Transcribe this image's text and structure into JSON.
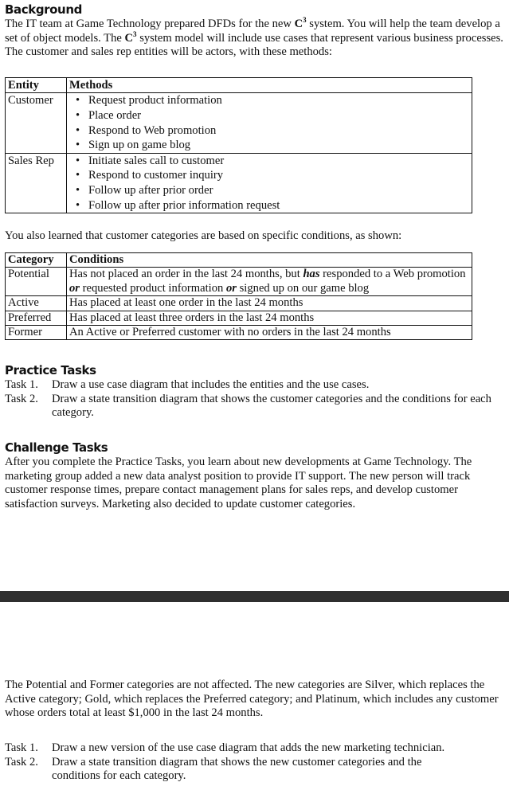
{
  "background": {
    "heading": "Background",
    "para_part1": "The IT team at Game Technology prepared DFDs for the new ",
    "system_name": "C",
    "system_sup": "3",
    "para_part2": " system. You will help the team develop a set of object models. The ",
    "para_part3": " system model will include use cases that represent various business processes. The customer and sales rep entities will be actors, with these methods:"
  },
  "entities_table": {
    "headers": [
      "Entity",
      "Methods"
    ],
    "rows": [
      {
        "entity": "Customer",
        "methods": [
          "Request product information",
          "Place order",
          "Respond to Web promotion",
          "Sign up on game blog"
        ]
      },
      {
        "entity": "Sales Rep",
        "methods": [
          "Initiate sales call to customer",
          "Respond to customer inquiry",
          "Follow up after prior order",
          "Follow up after prior information request"
        ]
      }
    ],
    "bullet": "•"
  },
  "categories_intro": "You also learned that customer categories are based on specific conditions, as shown:",
  "categories_table": {
    "headers": [
      "Category",
      "Conditions"
    ],
    "rows": [
      {
        "category": "Potential",
        "cond_a": "Has not placed an order in the last 24 months, but ",
        "cond_b": "has",
        "cond_c": " responded to a Web promotion ",
        "cond_d": "or",
        "cond_e": " requested product information ",
        "cond_f": "or",
        "cond_g": " signed up on our game blog"
      },
      {
        "category": "Active",
        "condition": "Has placed at least one order in the last 24 months"
      },
      {
        "category": "Preferred",
        "condition": "Has placed at least three orders in the last 24 months"
      },
      {
        "category": "Former",
        "condition": "An Active or Preferred customer with no orders in the last 24 months"
      }
    ]
  },
  "practice_tasks": {
    "heading": "Practice Tasks",
    "tasks": [
      {
        "label": "Task 1.",
        "text": "Draw a use case diagram that includes the entities and the use cases."
      },
      {
        "label": "Task 2.",
        "text": "Draw a state transition diagram that shows the customer categories and the conditions for each category."
      }
    ]
  },
  "challenge_tasks": {
    "heading": "Challenge Tasks",
    "paragraph": "After you complete the Practice Tasks, you learn about new developments at Game Technology. The marketing group added a new data analyst position to provide IT support. The new person will track customer response times, prepare contact management plans for sales reps, and develop customer satisfaction surveys. Marketing also decided to update customer categories."
  },
  "continued": {
    "paragraph": "The Potential and Former categories are not affected. The new categories are Silver, which replaces the Active category; Gold, which replaces the Preferred category; and Platinum, which includes any customer whose orders total at least $1,000 in the last 24 months.",
    "tasks": [
      {
        "label": "Task 1.",
        "text": "Draw a new version of the use case diagram that adds the new marketing technician."
      },
      {
        "label": "Task 2.",
        "text": "Draw a state transition diagram that shows the new customer categories and the conditions for each category."
      }
    ]
  },
  "colors": {
    "page_break_band": "#2f2f2f",
    "text": "#111111"
  }
}
